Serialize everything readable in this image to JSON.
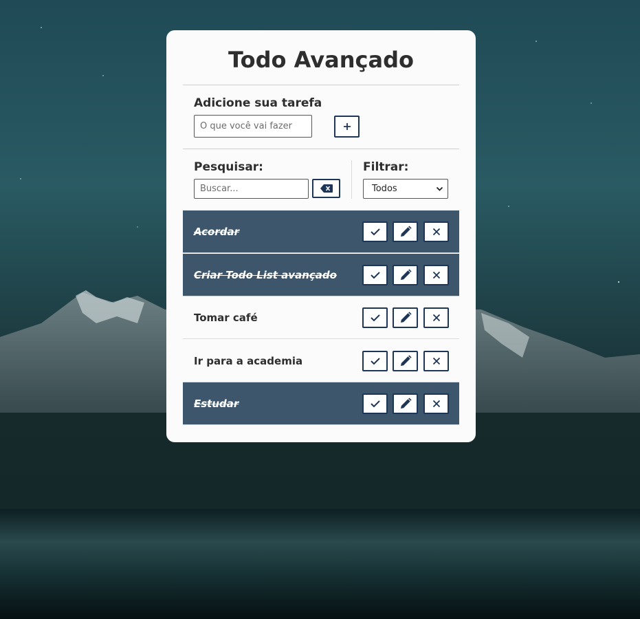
{
  "app": {
    "title": "Todo Avançado"
  },
  "add": {
    "label": "Adicione sua tarefa",
    "placeholder": "O que você vai fazer",
    "value": "",
    "button_icon": "plus-icon",
    "button_label": "+"
  },
  "search": {
    "label": "Pesquisar:",
    "placeholder": "Buscar...",
    "value": "",
    "clear_icon": "backspace-icon"
  },
  "filter": {
    "label": "Filtrar:",
    "selected": "Todos"
  },
  "todos": [
    {
      "text": "Acordar",
      "done": true
    },
    {
      "text": "Criar Todo List avançado",
      "done": true
    },
    {
      "text": "Tomar café",
      "done": false
    },
    {
      "text": "Ir para a academia",
      "done": false
    },
    {
      "text": "Estudar",
      "done": true
    }
  ],
  "actions": {
    "finish_icon": "check-icon",
    "edit_icon": "pencil-icon",
    "remove_icon": "close-icon"
  },
  "colors": {
    "accent": "#1d3557",
    "done_row": "#3e566c",
    "card": "#fbfbfc"
  }
}
